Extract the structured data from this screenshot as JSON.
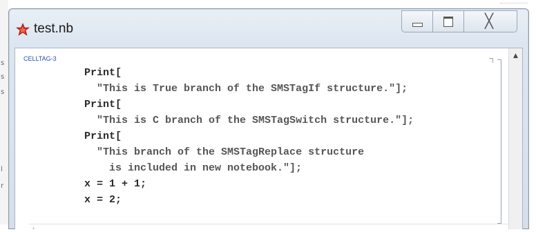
{
  "window": {
    "title": "test.nb",
    "icon": "mathematica-spikey-icon",
    "accent_color": "#d4281c"
  },
  "controls": {
    "minimize_icon": "minimize-icon",
    "maximize_icon": "maximize-icon",
    "close_icon": "close-icon",
    "close_glyph": "╳"
  },
  "cell": {
    "tag": "CELLTAG-3",
    "lines": [
      {
        "indent": "",
        "code": "Print[",
        "string": ""
      },
      {
        "indent": "  ",
        "code": "",
        "string": "\"This is True branch of the SMSTagIf structure.\"];"
      },
      {
        "indent": "",
        "code": "Print[",
        "string": ""
      },
      {
        "indent": "  ",
        "code": "",
        "string": "\"This is C branch of the SMSTagSwitch structure.\"];"
      },
      {
        "indent": "",
        "code": "Print[",
        "string": ""
      },
      {
        "indent": "  ",
        "code": "",
        "string": "\"This branch of the SMSTagReplace structure"
      },
      {
        "indent": "    ",
        "code": "",
        "string": "is included in new notebook.\"];"
      },
      {
        "indent": "",
        "code": "x = 1 + 1;",
        "string": ""
      },
      {
        "indent": "",
        "code": "x = 2;",
        "string": ""
      }
    ]
  },
  "scrollbar": {
    "up_arrow": "▲",
    "icon": "scroll-up-arrow-icon"
  }
}
